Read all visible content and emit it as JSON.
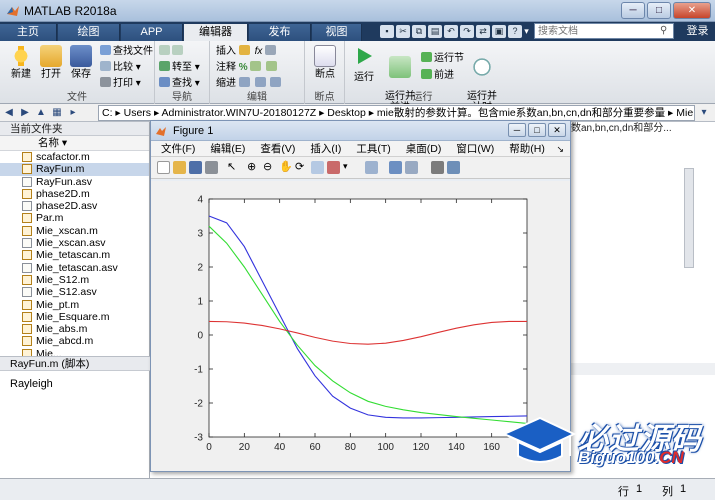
{
  "window": {
    "title": "MATLAB R2018a",
    "minimize": "─",
    "maximize": "□",
    "close": "✕"
  },
  "tabs": [
    {
      "label": "主页",
      "active": false
    },
    {
      "label": "绘图",
      "active": false
    },
    {
      "label": "APP",
      "active": false
    },
    {
      "label": "编辑器",
      "active": true
    },
    {
      "label": "发布",
      "active": false
    },
    {
      "label": "视图",
      "active": false
    }
  ],
  "search": {
    "placeholder": "搜索文档"
  },
  "login_label": "登录",
  "ribbon": {
    "file_group": {
      "label": "文件",
      "new": "新建",
      "open": "打开",
      "save": "保存",
      "find_files": "查找文件",
      "compare": "比较",
      "print": "打印"
    },
    "nav_group": {
      "label": "导航",
      "goto": "转至",
      "find": "查找"
    },
    "edit_group": {
      "label": "编辑",
      "insert": "插入",
      "comment": "注释",
      "indent": "缩进"
    },
    "breakpoint_group": {
      "label": "断点",
      "breakpoints": "断点"
    },
    "run_group": {
      "label": "运行",
      "run": "运行",
      "run_advance": "运行并\n前进",
      "run_section": "运行节",
      "advance": "前进",
      "run_time": "运行并\n计时"
    }
  },
  "address": {
    "segments": "C: ▸ Users ▸ Administrator.WIN7U-20180127Z ▸ Desktop ▸ mie散射的参数计算。包含mie系数an,bn,cn,dn和部分重要参量 ▸ Mie"
  },
  "left_panel": {
    "title": "当前文件夹",
    "column_name": "名称 ▾",
    "files": [
      {
        "name": "scafactor.m",
        "type": "m",
        "selected": false
      },
      {
        "name": "RayFun.m",
        "type": "m",
        "selected": true
      },
      {
        "name": "RayFun.asv",
        "type": "asv",
        "selected": false
      },
      {
        "name": "phase2D.m",
        "type": "m",
        "selected": false
      },
      {
        "name": "phase2D.asv",
        "type": "asv",
        "selected": false
      },
      {
        "name": "Par.m",
        "type": "m",
        "selected": false
      },
      {
        "name": "Mie_xscan.m",
        "type": "m",
        "selected": false
      },
      {
        "name": "Mie_xscan.asv",
        "type": "asv",
        "selected": false
      },
      {
        "name": "Mie_tetascan.m",
        "type": "m",
        "selected": false
      },
      {
        "name": "Mie_tetascan.asv",
        "type": "asv",
        "selected": false
      },
      {
        "name": "Mie_S12.m",
        "type": "m",
        "selected": false
      },
      {
        "name": "Mie_S12.asv",
        "type": "asv",
        "selected": false
      },
      {
        "name": "Mie_pt.m",
        "type": "m",
        "selected": false
      },
      {
        "name": "Mie_Esquare.m",
        "type": "m",
        "selected": false
      },
      {
        "name": "Mie_abs.m",
        "type": "m",
        "selected": false
      },
      {
        "name": "Mie_abcd.m",
        "type": "m",
        "selected": false
      },
      {
        "name": "Mie...",
        "type": "m",
        "selected": false
      }
    ],
    "detail_title": "RayFun.m  (脚本)",
    "detail_text": "Rayleigh"
  },
  "right_header": "数an,bn,cn,dn和部分...",
  "status": {
    "row_label": "行",
    "row_value": "1",
    "col_label": "列",
    "col_value": "1"
  },
  "figure": {
    "title": "Figure 1",
    "menu": [
      "文件(F)",
      "编辑(E)",
      "查看(V)",
      "插入(I)",
      "工具(T)",
      "桌面(D)",
      "窗口(W)",
      "帮助(H)"
    ]
  },
  "chart_data": {
    "type": "line",
    "title": "",
    "xlabel": "",
    "ylabel": "",
    "xlim": [
      0,
      180
    ],
    "ylim": [
      -3,
      4
    ],
    "xticks": [
      0,
      20,
      40,
      60,
      80,
      100,
      120,
      140,
      160
    ],
    "yticks": [
      -3,
      -2,
      -1,
      0,
      1,
      2,
      3,
      4
    ],
    "grid": false,
    "series": [
      {
        "color": "#3333dd",
        "x": [
          0,
          10,
          20,
          30,
          40,
          50,
          60,
          70,
          80,
          90,
          100,
          110,
          120,
          130,
          140,
          150,
          160,
          170,
          180
        ],
        "y": [
          3.5,
          3.3,
          2.6,
          1.6,
          0.6,
          -0.4,
          -1.2,
          -1.8,
          -2.15,
          -2.35,
          -2.42,
          -2.44,
          -2.44,
          -2.43,
          -2.42,
          -2.41,
          -2.4,
          -2.39,
          -2.38
        ]
      },
      {
        "color": "#33dd33",
        "x": [
          0,
          10,
          20,
          30,
          40,
          50,
          60,
          70,
          80,
          90,
          100,
          110,
          120,
          130,
          140,
          150,
          160,
          170,
          180
        ],
        "y": [
          3.2,
          2.7,
          2.0,
          1.2,
          0.4,
          -0.3,
          -0.9,
          -1.35,
          -1.7,
          -1.95,
          -2.1,
          -2.2,
          -2.28,
          -2.34,
          -2.4,
          -2.45,
          -2.5,
          -2.55,
          -2.6
        ]
      },
      {
        "color": "#dd3333",
        "x": [
          0,
          10,
          20,
          30,
          40,
          50,
          60,
          70,
          80,
          90,
          100,
          110,
          120,
          130,
          140,
          150,
          160,
          170,
          180
        ],
        "y": [
          0.4,
          0.39,
          0.35,
          0.28,
          0.18,
          0.06,
          -0.07,
          -0.18,
          -0.25,
          -0.27,
          -0.24,
          -0.16,
          -0.05,
          0.08,
          0.2,
          0.3,
          0.37,
          0.4,
          0.4
        ]
      }
    ]
  },
  "watermark": {
    "line1": "必过源码",
    "line2a": "Biguo100.",
    "line2b": "CN"
  }
}
